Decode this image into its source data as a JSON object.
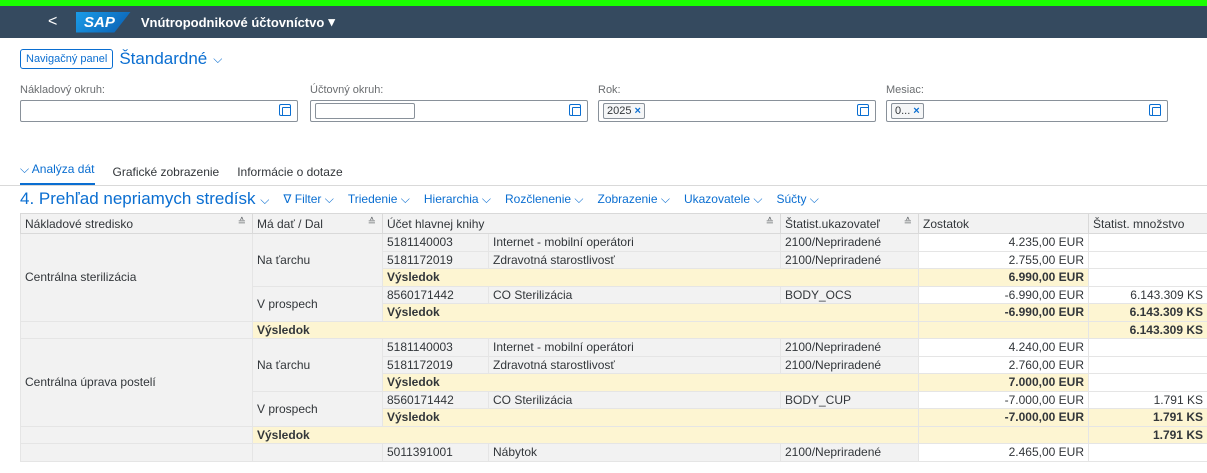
{
  "shell": {
    "back": "<",
    "logo": "SAP",
    "app_title": "Vnútropodnikové účtovníctvo",
    "app_title_arrow": "▾"
  },
  "variant": {
    "nav_button": "Navigačný panel",
    "name": "Štandardné",
    "chevron": "⌵"
  },
  "filters": {
    "naklad_label": "Nákladový okruh:",
    "uct_label": "Účtovný okruh:",
    "rok_label": "Rok:",
    "rok_token": "2025",
    "mesiac_label": "Mesiac:",
    "mesiac_token": "0...",
    "token_x": "×"
  },
  "tabs": [
    "Analýza dát",
    "Grafické zobrazenie",
    "Informácie o dotaze"
  ],
  "toolbar": {
    "view_title": "4. Prehľad nepriamych stredísk",
    "items": [
      "Filter",
      "Triedenie",
      "Hierarchia",
      "Rozčlenenie",
      "Zobrazenie",
      "Ukazovatele",
      "Súčty"
    ]
  },
  "columns": [
    "Nákladové stredisko",
    "Má dať / Dal",
    "Účet hlavnej knihy",
    "",
    "Štatist.ukazovateľ",
    "Zostatok",
    "Štatist. množstvo"
  ],
  "rows": {
    "cs_name": "Centrálna sterilizácia",
    "cup_name": "Centrálna úprava postelí",
    "na_tarchu": "Na ťarchu",
    "v_prospech": "V prospech",
    "vysledok": "Výsledok",
    "r1": [
      "5181140003",
      "Internet - mobilní operátori",
      "2100/Nepriradené",
      "4.235,00 EUR",
      ""
    ],
    "r2": [
      "5181172019",
      "Zdravotná starostlivosť",
      "2100/Nepriradené",
      "2.755,00 EUR",
      ""
    ],
    "r3": [
      "6.990,00 EUR",
      ""
    ],
    "r4": [
      "8560171442",
      "CO  Sterilizácia",
      "BODY_OCS",
      "-6.990,00 EUR",
      "6.143.309 KS"
    ],
    "r5": [
      "-6.990,00 EUR",
      "6.143.309 KS"
    ],
    "r6": [
      "",
      "6.143.309 KS"
    ],
    "r7": [
      "5181140003",
      "Internet - mobilní operátori",
      "2100/Nepriradené",
      "4.240,00 EUR",
      ""
    ],
    "r8": [
      "5181172019",
      "Zdravotná starostlivosť",
      "2100/Nepriradené",
      "2.760,00 EUR",
      ""
    ],
    "r9": [
      "7.000,00 EUR",
      ""
    ],
    "r10": [
      "8560171442",
      "CO  Sterilizácia",
      "BODY_CUP",
      "-7.000,00 EUR",
      "1.791 KS"
    ],
    "r11": [
      "-7.000,00 EUR",
      "1.791 KS"
    ],
    "r12": [
      "",
      "1.791 KS"
    ],
    "r13": [
      "5011391001",
      "Nábytok",
      "2100/Nepriradené",
      "2.465,00 EUR",
      ""
    ]
  }
}
